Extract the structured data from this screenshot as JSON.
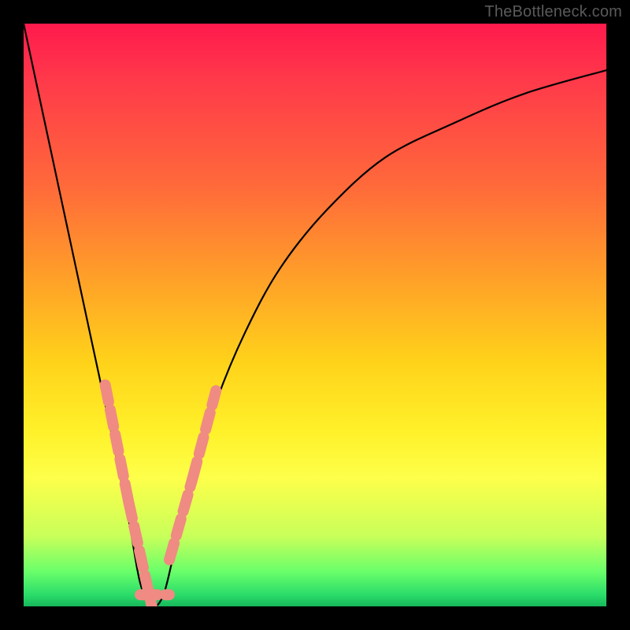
{
  "watermark": "TheBottleneck.com",
  "chart_data": {
    "type": "line",
    "title": "",
    "xlabel": "",
    "ylabel": "",
    "xlim": [
      0,
      100
    ],
    "ylim": [
      0,
      100
    ],
    "notes": "Bottleneck V-curve over a vertical red→green gradient background. Curve minimum near x≈22, y≈0. Left branch is steep; right branch rises more gradually. Axes and tick labels are not rendered.",
    "series": [
      {
        "name": "bottleneck-curve",
        "x": [
          0,
          3,
          6,
          9,
          12,
          15,
          18,
          20,
          22,
          24,
          26,
          29,
          33,
          38,
          44,
          52,
          62,
          74,
          86,
          100
        ],
        "y": [
          100,
          86,
          72,
          58,
          44,
          30,
          15,
          4,
          0,
          2,
          10,
          22,
          35,
          47,
          58,
          68,
          77,
          83,
          88,
          92
        ]
      }
    ],
    "highlight_segments": [
      {
        "name": "left-upper",
        "x": [
          14,
          18
        ],
        "y": [
          38,
          18
        ]
      },
      {
        "name": "left-lower",
        "x": [
          18,
          22
        ],
        "y": [
          18,
          0
        ]
      },
      {
        "name": "bottom",
        "x": [
          20,
          25
        ],
        "y": [
          2,
          2
        ]
      },
      {
        "name": "right-lower",
        "x": [
          25,
          29
        ],
        "y": [
          8,
          22
        ]
      },
      {
        "name": "right-upper",
        "x": [
          29,
          33
        ],
        "y": [
          22,
          37
        ]
      }
    ],
    "gradient_stops": [
      {
        "pos": 0,
        "color": "#ff1a4d"
      },
      {
        "pos": 28,
        "color": "#ff6a3a"
      },
      {
        "pos": 58,
        "color": "#ffd21a"
      },
      {
        "pos": 78,
        "color": "#fdff4a"
      },
      {
        "pos": 94,
        "color": "#6aff6a"
      },
      {
        "pos": 100,
        "color": "#16b85a"
      }
    ]
  }
}
